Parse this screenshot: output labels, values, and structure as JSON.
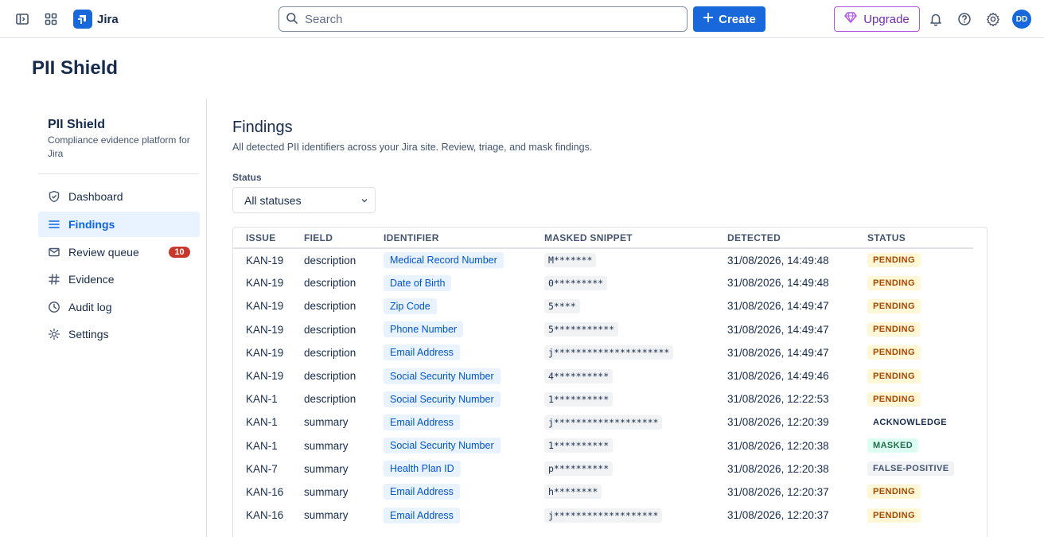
{
  "topbar": {
    "app_name": "Jira",
    "search_placeholder": "Search",
    "create_label": "Create",
    "upgrade_label": "Upgrade",
    "avatar_initials": "DD",
    "icons": [
      "sidebar-toggle-icon",
      "app-switcher-icon",
      "bell-icon",
      "help-icon",
      "gear-icon"
    ]
  },
  "page_title": "PII Shield",
  "sidebar": {
    "title": "PII Shield",
    "subtitle": "Compliance evidence platform for Jira",
    "items": [
      {
        "label": "Dashboard",
        "icon": "shield-icon"
      },
      {
        "label": "Findings",
        "icon": "list-icon",
        "active": true
      },
      {
        "label": "Review queue",
        "icon": "mail-icon",
        "badge": "10"
      },
      {
        "label": "Evidence",
        "icon": "hash-icon"
      },
      {
        "label": "Audit log",
        "icon": "clock-icon"
      },
      {
        "label": "Settings",
        "icon": "sun-gear-icon"
      }
    ]
  },
  "main": {
    "title": "Findings",
    "description": "All detected PII identifiers across your Jira site. Review, triage, and mask findings.",
    "status_filter": {
      "label": "Status",
      "selected": "All statuses"
    },
    "table": {
      "columns": [
        "ISSUE",
        "FIELD",
        "IDENTIFIER",
        "MASKED SNIPPET",
        "DETECTED",
        "STATUS"
      ],
      "rows": [
        [
          "KAN-19",
          "description",
          "Medical Record Number",
          "M*******",
          "31/08/2026, 14:49:48",
          "PENDING"
        ],
        [
          "KAN-19",
          "description",
          "Date of Birth",
          "0*********",
          "31/08/2026, 14:49:48",
          "PENDING"
        ],
        [
          "KAN-19",
          "description",
          "Zip Code",
          "5****",
          "31/08/2026, 14:49:47",
          "PENDING"
        ],
        [
          "KAN-19",
          "description",
          "Phone Number",
          "5***********",
          "31/08/2026, 14:49:47",
          "PENDING"
        ],
        [
          "KAN-19",
          "description",
          "Email Address",
          "j*********************",
          "31/08/2026, 14:49:47",
          "PENDING"
        ],
        [
          "KAN-19",
          "description",
          "Social Security Number",
          "4**********",
          "31/08/2026, 14:49:46",
          "PENDING"
        ],
        [
          "KAN-1",
          "description",
          "Social Security Number",
          "1**********",
          "31/08/2026, 12:22:53",
          "PENDING"
        ],
        [
          "KAN-1",
          "summary",
          "Email Address",
          "j*******************",
          "31/08/2026, 12:20:39",
          "ACKNOWLEDGE"
        ],
        [
          "KAN-1",
          "summary",
          "Social Security Number",
          "1**********",
          "31/08/2026, 12:20:38",
          "MASKED"
        ],
        [
          "KAN-7",
          "summary",
          "Health Plan ID",
          "p**********",
          "31/08/2026, 12:20:38",
          "FALSE-POSITIVE"
        ],
        [
          "KAN-16",
          "summary",
          "Email Address",
          "h********",
          "31/08/2026, 12:20:37",
          "PENDING"
        ],
        [
          "KAN-16",
          "summary",
          "Email Address",
          "j*******************",
          "31/08/2026, 12:20:37",
          "PENDING"
        ]
      ]
    }
  }
}
